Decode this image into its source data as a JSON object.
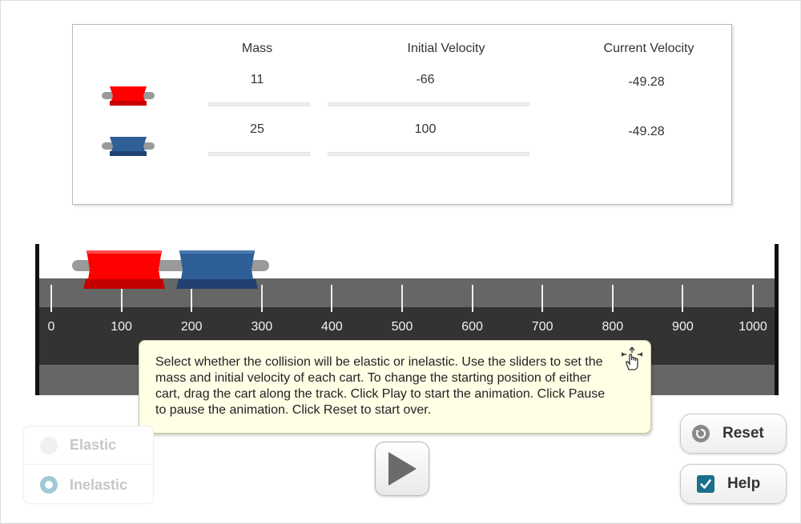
{
  "table": {
    "headers": {
      "mass": "Mass",
      "initial_velocity": "Initial Velocity",
      "current_velocity": "Current Velocity"
    },
    "rows": [
      {
        "cart": "red",
        "mass": "11",
        "initial_velocity": "-66",
        "current_velocity": "-49.28"
      },
      {
        "cart": "blue",
        "mass": "25",
        "initial_velocity": "100",
        "current_velocity": "-49.28"
      }
    ]
  },
  "track": {
    "ticks": [
      "0",
      "100",
      "200",
      "300",
      "400",
      "500",
      "600",
      "700",
      "800",
      "900",
      "1000"
    ]
  },
  "tooltip": {
    "text": "Select whether the collision will be elastic or inelastic. Use the sliders to set the mass and initial velocity of each cart. To change the starting position of either cart, drag the cart along the track. Click Play to start the animation. Click Pause to pause the animation. Click Reset to start over."
  },
  "collision_type": {
    "options": [
      "Elastic",
      "Inelastic"
    ],
    "selected": "Inelastic"
  },
  "buttons": {
    "play_icon": "play-icon",
    "reset_label": "Reset",
    "help_label": "Help"
  },
  "colors": {
    "red_cart": "#ff0000",
    "blue_cart": "#2e5f96",
    "accent": "#1b6f8c"
  }
}
